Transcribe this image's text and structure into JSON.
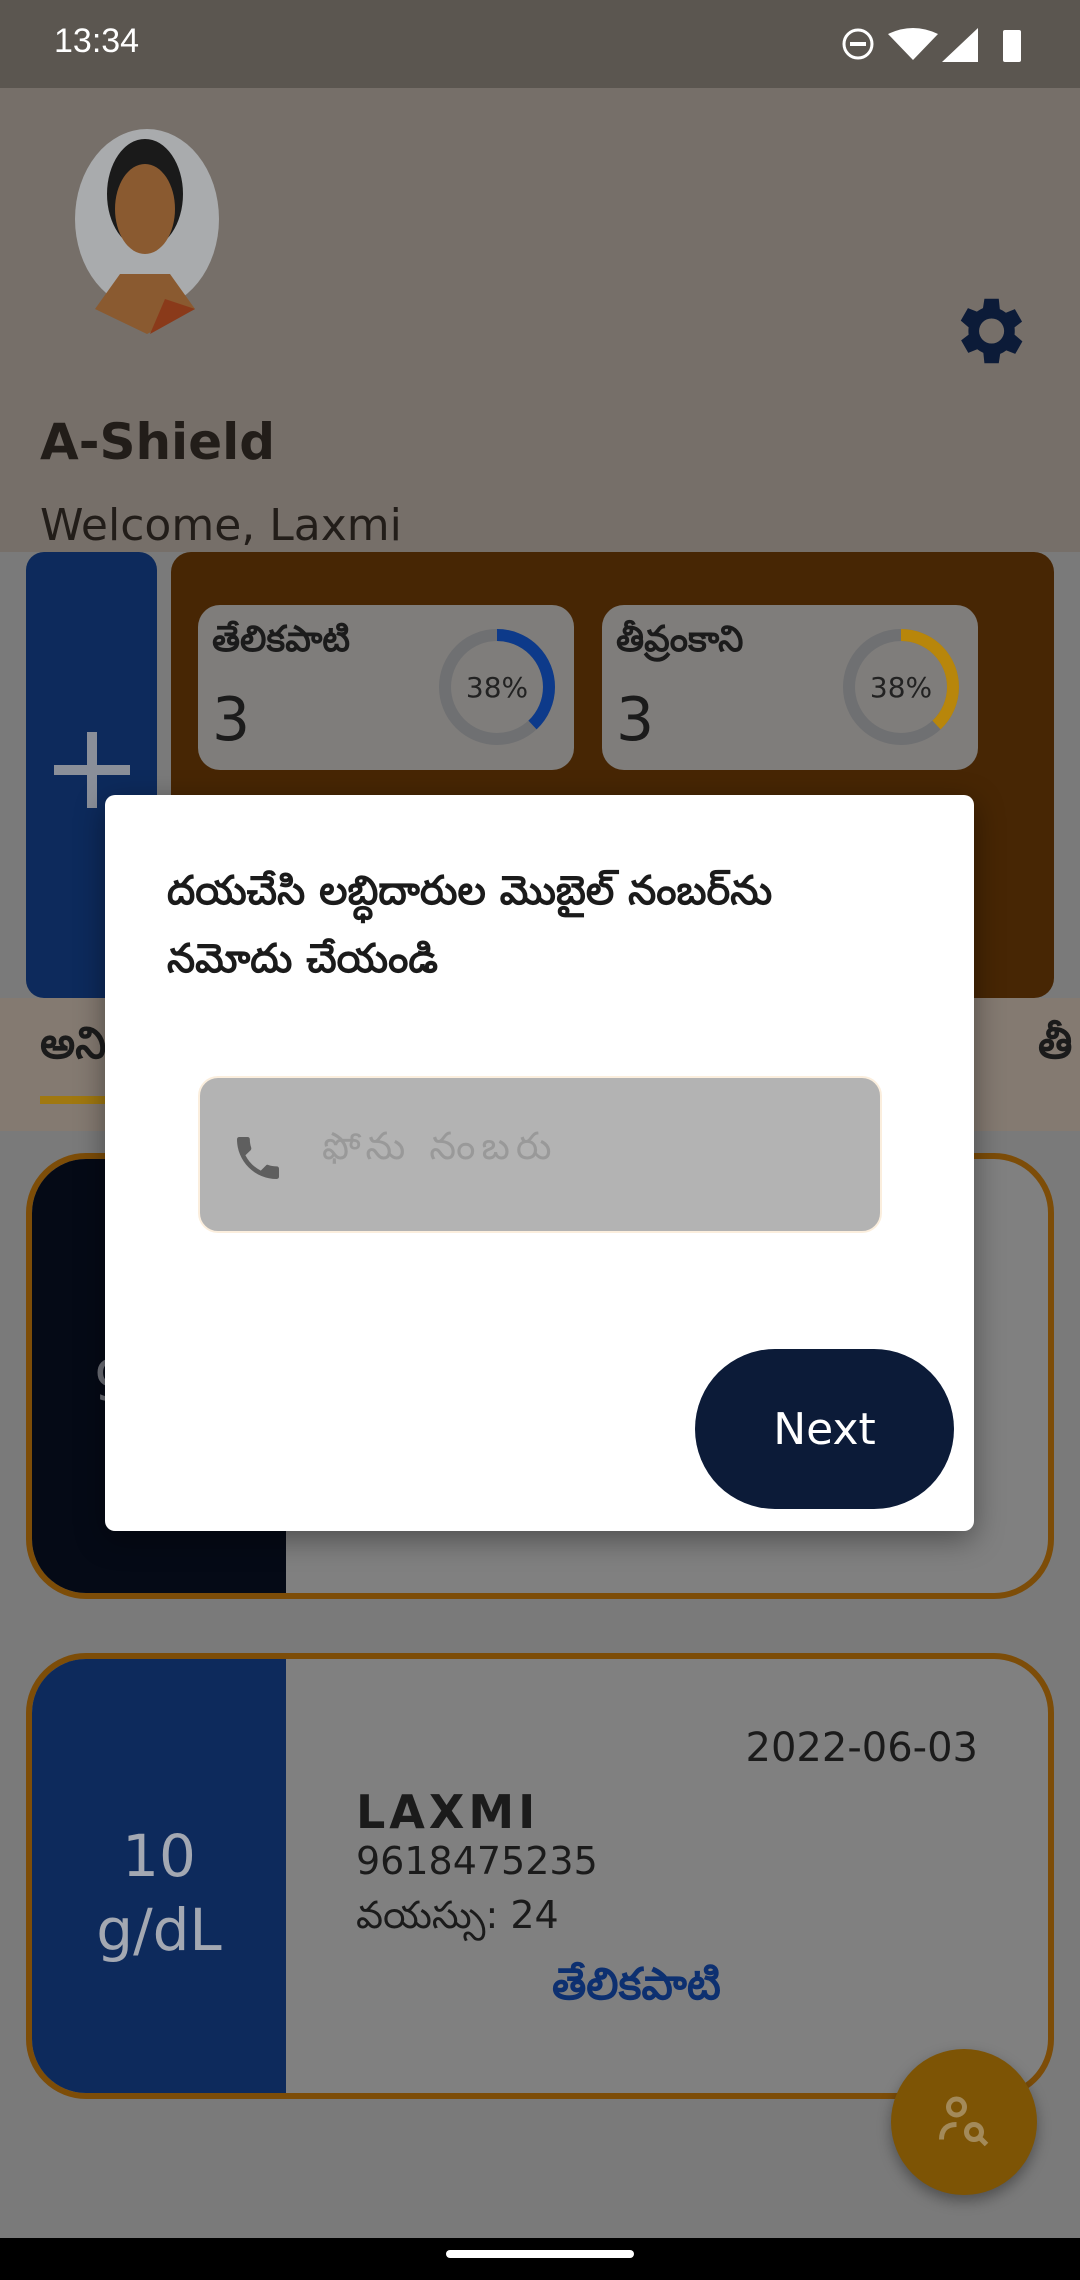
{
  "status_bar": {
    "time": "13:34",
    "icons": [
      "do-not-disturb-icon",
      "wifi-icon",
      "signal-icon",
      "battery-icon"
    ]
  },
  "header": {
    "app_title": "A-Shield",
    "welcome": "Welcome, Laxmi"
  },
  "stats": [
    {
      "label": "తేలికపాటి",
      "count": "3",
      "percent_label": "38%",
      "percent": 38,
      "color": "#0d3a8a"
    },
    {
      "label": "తీవ్రంకాని",
      "count": "3",
      "percent_label": "38%",
      "percent": 38,
      "color": "#b8860b"
    }
  ],
  "tabs": [
    {
      "label": "అని"
    },
    {
      "label": "తీ"
    }
  ],
  "cards": [
    {
      "hb": "9"
    },
    {
      "hb_value": "10",
      "hb_unit": "g/dL",
      "date": "2022-06-03",
      "name": "LAXMI",
      "phone": "9618475235",
      "age": "వయస్సు: 24",
      "severity": "తేలికపాటి"
    }
  ],
  "dialog": {
    "title": "దయచేసి లబ్ధిదారుల మొబైల్ నంబర్‌ను నమోదు చేయండి",
    "phone_placeholder": "ఫోను నంబరు",
    "next_label": "Next"
  },
  "colors": {
    "navy": "#0c1b38",
    "accent": "#b8860b"
  }
}
